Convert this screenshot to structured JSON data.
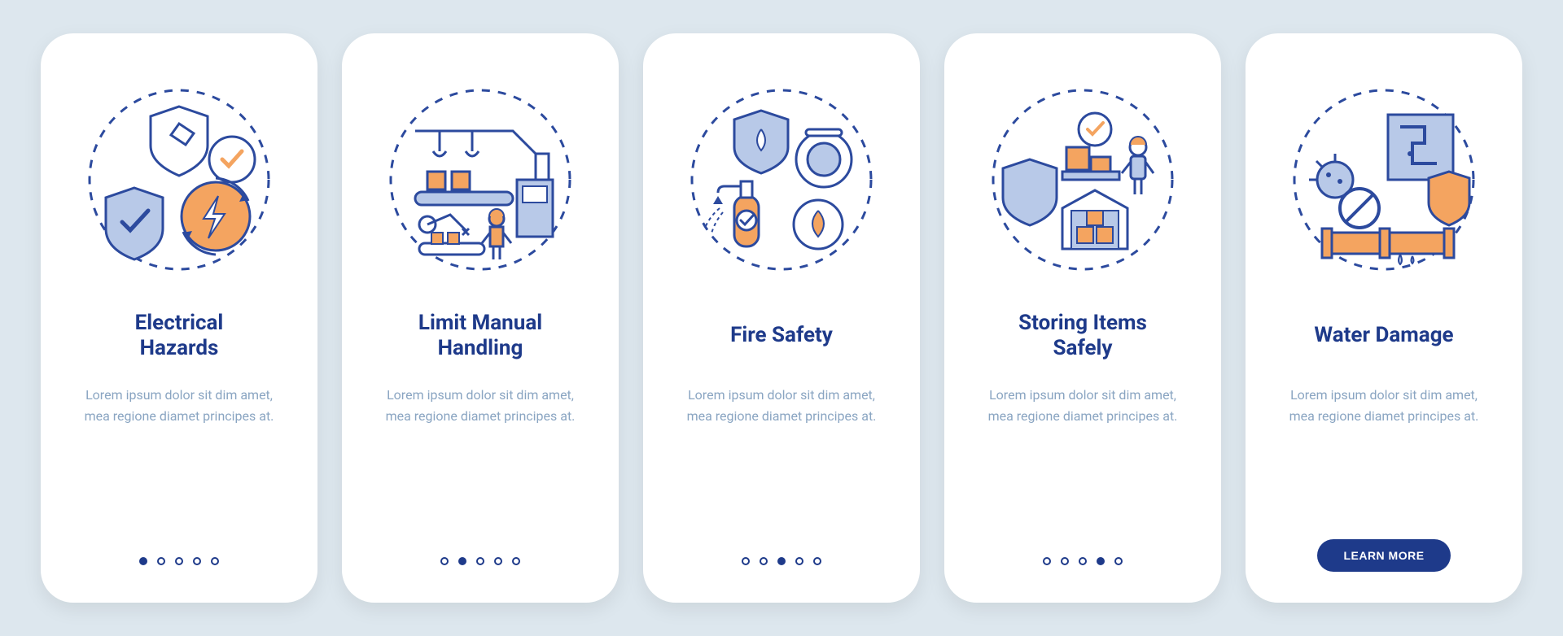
{
  "colors": {
    "navy": "#1e3a8a",
    "orange": "#f4a460",
    "lightblue": "#b8c9e8",
    "paleblue": "#dde7ee",
    "outline": "#2c4a9e"
  },
  "screens": [
    {
      "id": "electrical-hazards",
      "title": "Electrical\nHazards",
      "body": "Lorem ipsum dolor sit dim amet, mea regione diamet principes at.",
      "activeDot": 0,
      "icon": "electrical"
    },
    {
      "id": "limit-manual-handling",
      "title": "Limit Manual\nHandling",
      "body": "Lorem ipsum dolor sit dim amet, mea regione diamet principes at.",
      "activeDot": 1,
      "icon": "manual"
    },
    {
      "id": "fire-safety",
      "title": "Fire Safety",
      "body": "Lorem ipsum dolor sit dim amet, mea regione diamet principes at.",
      "activeDot": 2,
      "icon": "fire"
    },
    {
      "id": "storing-items-safely",
      "title": "Storing Items\nSafely",
      "body": "Lorem ipsum dolor sit dim amet, mea regione diamet principes at.",
      "activeDot": 3,
      "icon": "storing"
    },
    {
      "id": "water-damage",
      "title": "Water Damage",
      "body": "Lorem ipsum dolor sit dim amet, mea regione diamet principes at.",
      "cta": "LEARN MORE",
      "icon": "water"
    }
  ]
}
